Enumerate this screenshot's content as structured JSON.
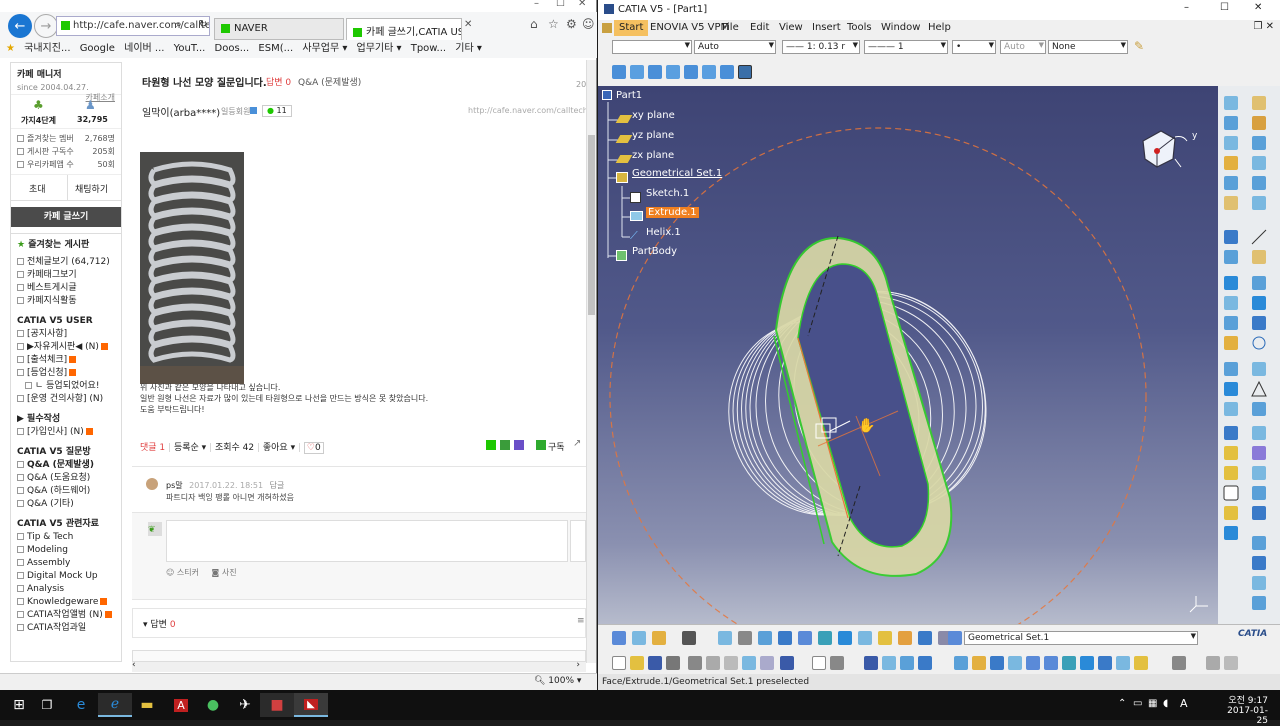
{
  "browser": {
    "address": "http://cafe.naver.com/callter",
    "tabs": [
      {
        "label": "NAVER"
      },
      {
        "label": "카페 글쓰기,CATIA USER ..."
      }
    ],
    "favorites": [
      "국내지진...",
      "Google",
      "네이버 ...",
      "YouT...",
      "Doos...",
      "ESM(...",
      "사무업무 ▾",
      "업무기타 ▾",
      "Tpow...",
      "기타 ▾"
    ],
    "zoom": "100%",
    "sidebar": {
      "cafe_name": "카페 매니저",
      "cafe_intro": "카페소개",
      "since": "since 2004.04.27.",
      "level_label": "가지4단계",
      "members": "32,795",
      "stats": [
        {
          "label": "즐겨찾는 멤버",
          "value": "2,768명"
        },
        {
          "label": "게시판 구독수",
          "value": "205회"
        },
        {
          "label": "우리카페앱 수",
          "value": "50회"
        }
      ],
      "invite": "초대",
      "chat": "채팅하기",
      "write": "카페 글쓰기",
      "fav_boards": "즐겨찾는 게시판",
      "menu_top": [
        "전체글보기 (64,712)",
        "카페태그보기",
        "베스트게시글",
        "카페지식활동"
      ],
      "sec_user": "CATIA V5 USER",
      "menu_user": [
        "[공지사항]",
        "▶자유게시판◀ (N)",
        "[출석체크]",
        "[등업신청]",
        "ㄴ 등업되었어요!",
        "[운영 건의사항] (N)"
      ],
      "sec_required": "▶ 필수작성",
      "menu_required": [
        "[가입인사] (N)"
      ],
      "sec_qna": "CATIA V5 질문방",
      "menu_qna": [
        "Q&A (문제발생)",
        "Q&A (도움요청)",
        "Q&A (하드웨어)",
        "Q&A (기타)"
      ],
      "sec_ref": "CATIA V5 관련자료",
      "menu_ref": [
        "Tip & Tech",
        "Modeling",
        "Assembly",
        "Digital Mock Up",
        "Analysis",
        "Knowledgeware",
        "CATIA작업앨범 (N)",
        "CATIA작업과일"
      ]
    },
    "post": {
      "title": "타원형 나선 모양 질문입니다.",
      "answer_tag": "답변 0",
      "board": "Q&A (문제발생)",
      "date_fragment": "20",
      "author": "일막이(arba****)",
      "author_grade": "일등회원",
      "comment_badge": "11",
      "url": "http://cafe.naver.com/calltech/",
      "body": [
        "위 사진과 같은 모양을 나타내고 싶습니다.",
        "일반 원형 나선은 자료가 많이 있는데 타원형으로 나선을 만드는 방식은 못 찾았습니다.",
        "도움 부탁드립니다!"
      ],
      "comments_count_label": "댓글 1",
      "sort_label": "등록순 ▾",
      "views_label": "조회수 42",
      "like_label": "좋아요 ▾",
      "like_count": "0",
      "subscribe": "구독",
      "comment": {
        "author": "ps말",
        "date": "2017.01.22. 18:51",
        "reply": "답글",
        "text": "파트디자 백잉 팽롤 아니면 개혀하셨음"
      },
      "sticker": "스티커",
      "photo": "사진",
      "answer_section": "답변",
      "answer_count": "0"
    }
  },
  "catia": {
    "window_title": "CATIA V5 - [Part1]",
    "menu": [
      "Start",
      "ENOVIA V5 VPM",
      "File",
      "Edit",
      "View",
      "Insert",
      "Tools",
      "Window",
      "Help"
    ],
    "tb_combos": [
      "",
      "Auto",
      "1: 0.13 r",
      "1",
      "•",
      "Auto",
      "None"
    ],
    "tree": [
      {
        "label": "Part1"
      },
      {
        "label": "xy plane"
      },
      {
        "label": "yz plane"
      },
      {
        "label": "zx plane"
      },
      {
        "label": "Geometrical Set.1"
      },
      {
        "label": "Sketch.1"
      },
      {
        "label": "Extrude.1"
      },
      {
        "label": "Helix.1"
      },
      {
        "label": "PartBody"
      }
    ],
    "compass_axis": "y",
    "bottom_combo": "Geometrical Set.1",
    "status": "Face/Extrude.1/Geometrical Set.1 preselected",
    "logo": "CATIA"
  },
  "taskbar": {
    "time": "오전 9:17",
    "date": "2017-01-25",
    "lang": "A"
  },
  "colors": {
    "selection": "#f08020",
    "highlight_green": "#34d02a",
    "surface": "#d6d6a2",
    "taskbar": "#101010"
  }
}
